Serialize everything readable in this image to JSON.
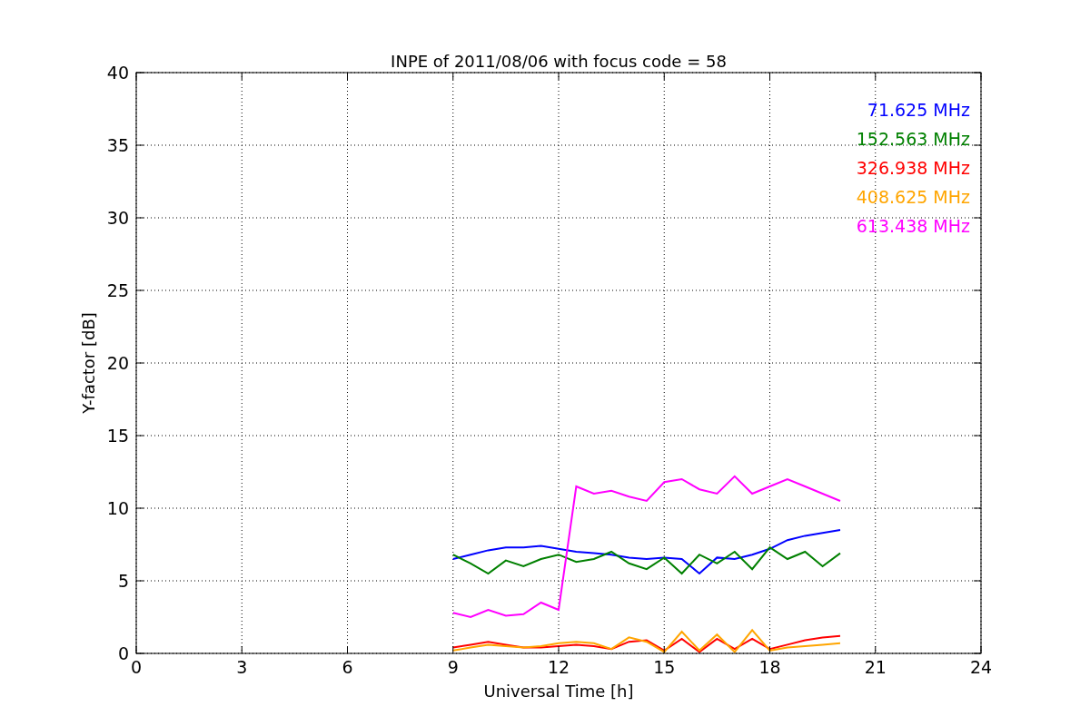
{
  "chart_data": {
    "type": "line",
    "title": "INPE of 2011/08/06 with focus code = 58",
    "xlabel": "Universal Time [h]",
    "ylabel": "Y-factor [dB]",
    "x": [
      9,
      9.5,
      10,
      10.5,
      11,
      11.5,
      12,
      12.5,
      13,
      13.5,
      14,
      14.5,
      15,
      15.5,
      16,
      16.5,
      17,
      17.5,
      18,
      18.5,
      19,
      19.5,
      20
    ],
    "series": [
      {
        "name": "71.625 MHz",
        "color": "#0000ff",
        "values": [
          6.5,
          6.8,
          7.1,
          7.3,
          7.3,
          7.4,
          7.2,
          7.0,
          6.9,
          6.8,
          6.6,
          6.5,
          6.6,
          6.5,
          5.5,
          6.6,
          6.5,
          6.8,
          7.2,
          7.8,
          8.1,
          8.3,
          8.5
        ]
      },
      {
        "name": "152.563 MHz",
        "color": "#008000",
        "values": [
          6.8,
          6.2,
          5.5,
          6.4,
          6.0,
          6.5,
          6.8,
          6.3,
          6.5,
          7.0,
          6.2,
          5.8,
          6.6,
          5.5,
          6.8,
          6.2,
          7.0,
          5.8,
          7.3,
          6.5,
          7.0,
          6.0,
          6.9
        ]
      },
      {
        "name": "326.938 MHz",
        "color": "#ff0000",
        "values": [
          0.4,
          0.6,
          0.8,
          0.6,
          0.4,
          0.4,
          0.5,
          0.6,
          0.5,
          0.3,
          0.8,
          0.9,
          0.2,
          1.0,
          0.1,
          1.0,
          0.3,
          1.0,
          0.3,
          0.6,
          0.9,
          1.1,
          1.2
        ]
      },
      {
        "name": "408.625 MHz",
        "color": "#ffa500",
        "values": [
          0.2,
          0.4,
          0.6,
          0.5,
          0.4,
          0.5,
          0.7,
          0.8,
          0.7,
          0.3,
          1.1,
          0.8,
          0.1,
          1.5,
          0.2,
          1.3,
          0.1,
          1.6,
          0.2,
          0.4,
          0.5,
          0.6,
          0.7
        ]
      },
      {
        "name": "613.438 MHz",
        "color": "#ff00ff",
        "values": [
          2.8,
          2.5,
          3.0,
          2.6,
          2.7,
          3.5,
          3.0,
          11.5,
          11.0,
          11.2,
          10.8,
          10.5,
          11.8,
          12.0,
          11.3,
          11.0,
          12.2,
          11.0,
          11.5,
          12.0,
          11.5,
          11.0,
          10.5
        ]
      }
    ],
    "xlim": [
      0,
      24
    ],
    "ylim": [
      0,
      40
    ],
    "xticks": [
      0,
      3,
      6,
      9,
      12,
      15,
      18,
      21,
      24
    ],
    "yticks": [
      0,
      5,
      10,
      15,
      20,
      25,
      30,
      35,
      40
    ],
    "grid": true
  }
}
